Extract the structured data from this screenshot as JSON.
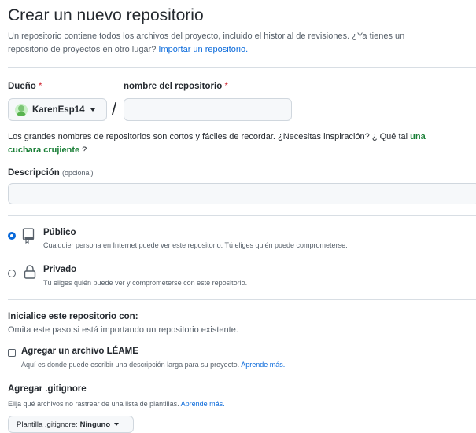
{
  "header": {
    "title": "Crear un nuevo repositorio",
    "subtitle_1": "Un repositorio contiene todos los archivos del proyecto, incluido el historial de revisiones. ¿Ya tienes un",
    "subtitle_2": "repositorio de proyectos en otro lugar?",
    "import_link": "Importar un repositorio."
  },
  "owner": {
    "label": "Dueño",
    "required": "*",
    "value": "KarenEsp14"
  },
  "repo_name": {
    "label": "nombre del repositorio",
    "required": "*",
    "value": "",
    "placeholder": ""
  },
  "suggestion": {
    "text_1": "Los grandes nombres de repositorios son cortos y fáciles de recordar. ¿Necesitas inspiración? ¿ Qué tal",
    "name_part1": "una",
    "name_part2": "cuchara crujiente",
    "end": "?"
  },
  "description": {
    "label": "Descripción",
    "optional": "(opcional)",
    "value": "",
    "placeholder": ""
  },
  "visibility": {
    "public": {
      "title": "Público",
      "desc": "Cualquier persona en Internet puede ver este repositorio. Tú eliges quién puede comprometerse.",
      "selected": true
    },
    "private": {
      "title": "Privado",
      "desc": "Tú eliges quién puede ver y comprometerse con este repositorio.",
      "selected": false
    }
  },
  "init": {
    "title": "Inicialice este repositorio con:",
    "subtitle": "Omita este paso si está importando un repositorio existente.",
    "readme_label": "Agregar un archivo LÉAME",
    "readme_desc": "Aquí es donde puede escribir una descripción larga para su proyecto.",
    "readme_link": "Aprende más.",
    "readme_checked": false
  },
  "gitignore": {
    "title": "Agregar .gitignore",
    "desc": "Elija qué archivos no rastrear de una lista de plantillas.",
    "link": "Aprende más.",
    "button_prefix": "Plantilla .gitignore:",
    "button_value": "Ninguno"
  },
  "colors": {
    "accent": "#0969da",
    "suggestion": "#1a7f37",
    "required": "#cf222e"
  }
}
